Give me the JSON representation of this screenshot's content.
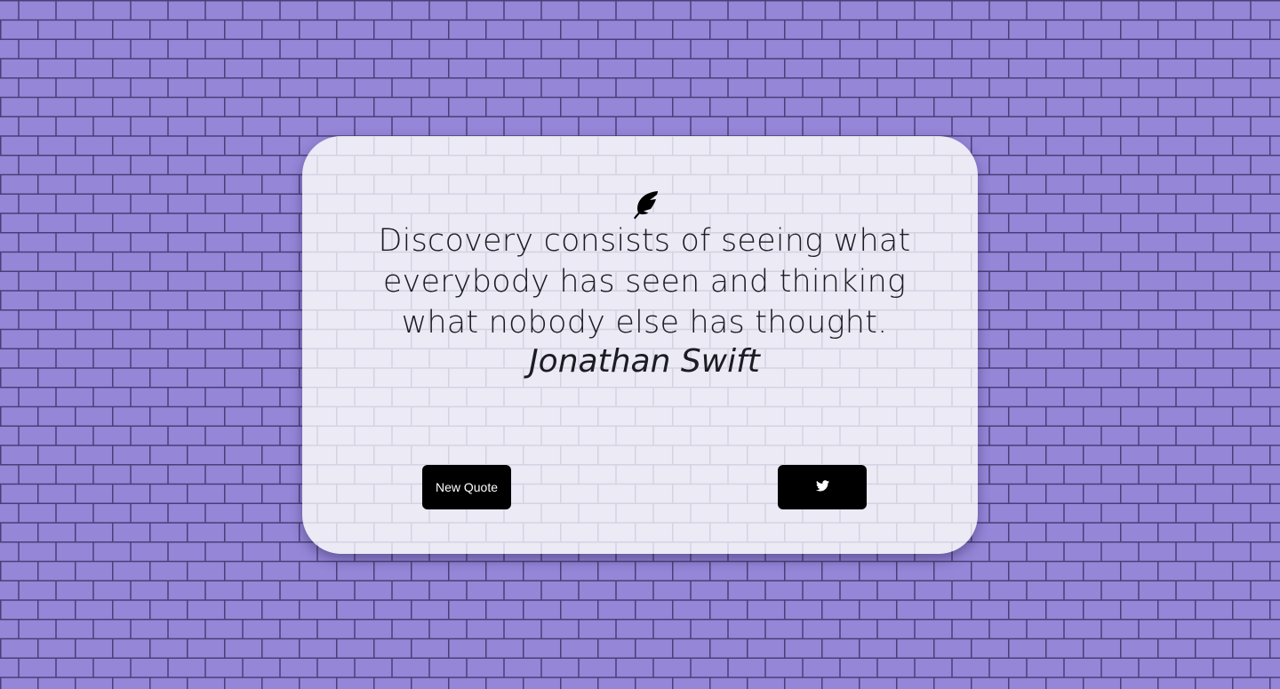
{
  "quote": {
    "text": "Discovery consists of seeing what everybody has seen and thinking what nobody else has thought.",
    "author": "Jonathan Swift"
  },
  "buttons": {
    "new_quote_label": "New Quote",
    "tweet_icon": "twitter-icon"
  },
  "header_icon": "feather-icon",
  "colors": {
    "background": "#9586d8",
    "brick_line": "#4a3f78",
    "card": "#efeff6",
    "button": "#000000",
    "button_text": "#ffffff"
  }
}
